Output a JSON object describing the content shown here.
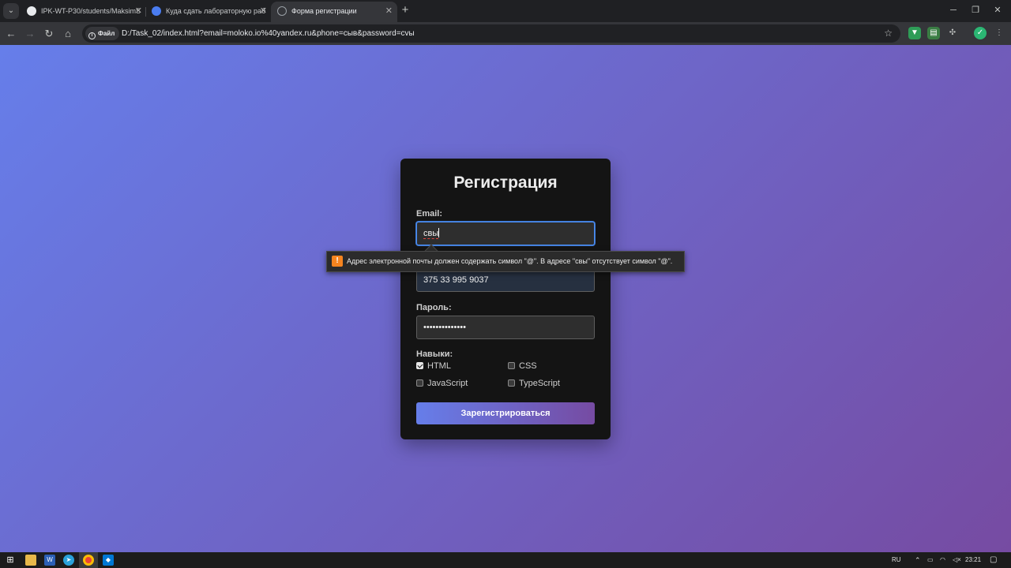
{
  "browser": {
    "tabs": [
      {
        "title": "IPK-WT-P30/students/MaksimS",
        "favicon": "github-icon",
        "active": false
      },
      {
        "title": "Куда сдать лабораторную раб",
        "favicon": "app-icon",
        "active": false
      },
      {
        "title": "Форма регистрации",
        "favicon": "globe-icon",
        "active": true
      }
    ],
    "new_tab_symbol": "+",
    "site_chip_label": "Файл",
    "url": "D:/Task_02/index.html?email=moloko.io%40yandex.ru&phone=сыв&password=сvы"
  },
  "form": {
    "title": "Регистрация",
    "email_label": "Email:",
    "email_value": "свы",
    "phone_value": "375 33 995 9037",
    "password_label": "Пароль:",
    "password_value": "••••••••••••••",
    "skills_label": "Навыки:",
    "skills": [
      {
        "label": "HTML",
        "checked": true
      },
      {
        "label": "CSS",
        "checked": false
      },
      {
        "label": "JavaScript",
        "checked": false
      },
      {
        "label": "TypeScript",
        "checked": false
      }
    ],
    "submit_label": "Зарегистрироваться"
  },
  "validation_tooltip": {
    "icon": "warning-icon",
    "message": "Адрес электронной почты должен содержать символ \"@\". В адресе \"свы\" отсутствует символ \"@\"."
  },
  "taskbar": {
    "language": "RU",
    "time": "23:21"
  },
  "colors": {
    "gradient_start": "#667eea",
    "gradient_end": "#764ba2",
    "card_bg": "#141414",
    "warning": "#f5841f"
  }
}
